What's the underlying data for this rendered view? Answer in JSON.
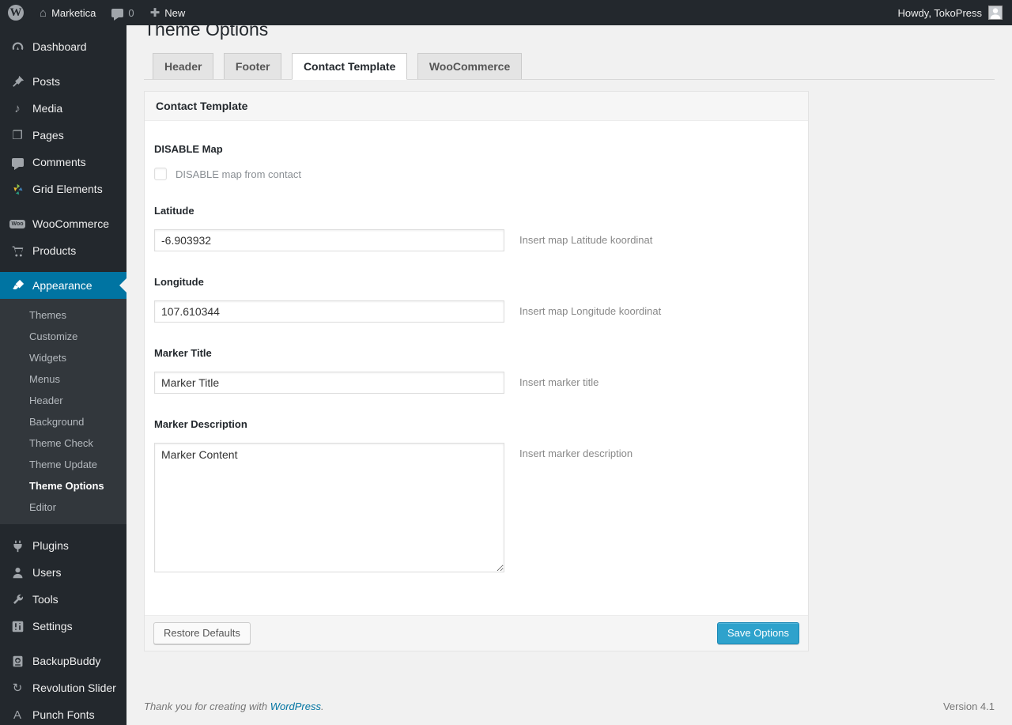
{
  "topbar": {
    "site_name": "Marketica",
    "comment_count": "0",
    "new_label": "New",
    "howdy": "Howdy, TokoPress"
  },
  "sidebar": {
    "items": [
      {
        "id": "dashboard",
        "label": "Dashboard"
      },
      {
        "id": "posts",
        "label": "Posts"
      },
      {
        "id": "media",
        "label": "Media"
      },
      {
        "id": "pages",
        "label": "Pages"
      },
      {
        "id": "comments",
        "label": "Comments"
      },
      {
        "id": "grid-elements",
        "label": "Grid Elements"
      },
      {
        "id": "woocommerce",
        "label": "WooCommerce"
      },
      {
        "id": "products",
        "label": "Products"
      },
      {
        "id": "appearance",
        "label": "Appearance",
        "active": true
      },
      {
        "id": "plugins",
        "label": "Plugins"
      },
      {
        "id": "users",
        "label": "Users"
      },
      {
        "id": "tools",
        "label": "Tools"
      },
      {
        "id": "settings",
        "label": "Settings"
      },
      {
        "id": "backupbuddy",
        "label": "BackupBuddy"
      },
      {
        "id": "revolution-slider",
        "label": "Revolution Slider"
      },
      {
        "id": "punch-fonts",
        "label": "Punch Fonts"
      }
    ],
    "appearance_submenu": [
      {
        "label": "Themes"
      },
      {
        "label": "Customize"
      },
      {
        "label": "Widgets"
      },
      {
        "label": "Menus"
      },
      {
        "label": "Header"
      },
      {
        "label": "Background"
      },
      {
        "label": "Theme Check"
      },
      {
        "label": "Theme Update"
      },
      {
        "label": "Theme Options",
        "current": true
      },
      {
        "label": "Editor"
      }
    ]
  },
  "page": {
    "title": "Theme Options",
    "tabs": [
      {
        "label": "Header",
        "active": false
      },
      {
        "label": "Footer",
        "active": false
      },
      {
        "label": "Contact Template",
        "active": true
      },
      {
        "label": "WooCommerce",
        "active": false
      }
    ],
    "panel": {
      "header": "Contact Template",
      "fields": {
        "disable_map": {
          "label": "DISABLE Map",
          "checkbox_label": "DISABLE map from contact",
          "checked": false
        },
        "latitude": {
          "label": "Latitude",
          "value": "-6.903932",
          "hint": "Insert map Latitude koordinat"
        },
        "longitude": {
          "label": "Longitude",
          "value": "107.610344",
          "hint": "Insert map Longitude koordinat"
        },
        "marker_title": {
          "label": "Marker Title",
          "value": "Marker Title",
          "hint": "Insert marker title"
        },
        "marker_description": {
          "label": "Marker Description",
          "value": "Marker Content",
          "hint": "Insert marker description"
        }
      },
      "restore_button": "Restore Defaults",
      "save_button": "Save Options"
    },
    "footer": {
      "thanks_prefix": "Thank you for creating with ",
      "wordpress_link": "WordPress",
      "thanks_suffix": ".",
      "version": "Version 4.1"
    }
  },
  "colors": {
    "admin_bar_bg": "#23282d",
    "submenu_bg": "#32373c",
    "active_blue": "#0074a2",
    "primary_button": "#2ea2cc",
    "content_bg": "#f1f1f1",
    "link_blue": "#0074a2"
  }
}
